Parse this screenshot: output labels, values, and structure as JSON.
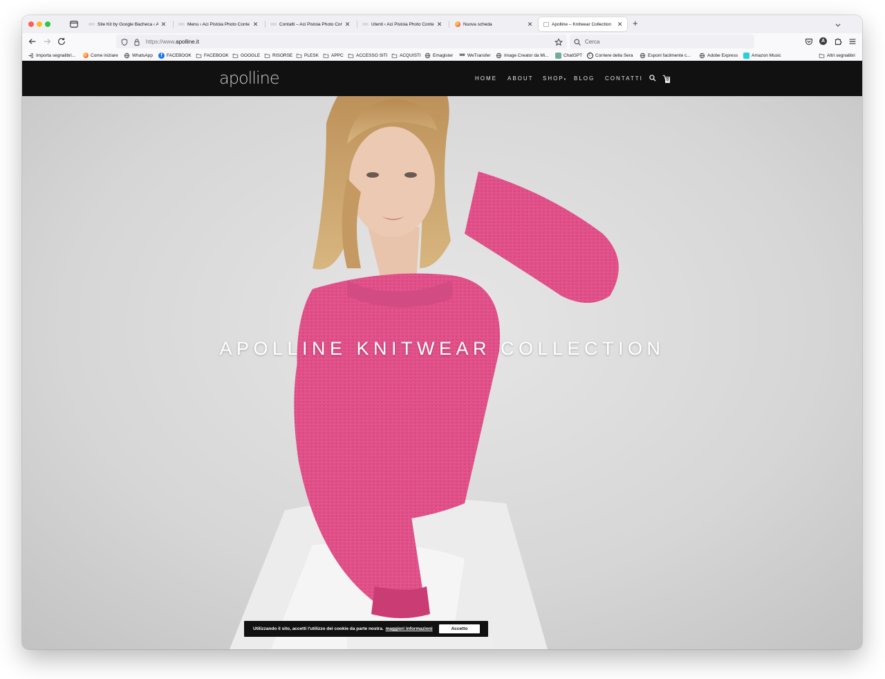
{
  "browser": {
    "tabs": [
      {
        "title": "Site Kit by Google Bacheca ‹ Aci",
        "favicon": "aci-favicon",
        "active": false
      },
      {
        "title": "Menu ‹ Aci Pistoia Photo Conte",
        "favicon": "aci-favicon",
        "active": false
      },
      {
        "title": "Contatti – Aci Pistoia Photo Con",
        "favicon": "aci-favicon",
        "active": false
      },
      {
        "title": "Utenti ‹ Aci Pistoia Photo Conte",
        "favicon": "aci-favicon",
        "active": false
      },
      {
        "title": "Nuova scheda",
        "favicon": "firefox-icon",
        "active": false
      },
      {
        "title": "Apolline – Knitwear Collection",
        "favicon": "apolline-favicon",
        "active": true
      }
    ],
    "url": {
      "prefix": "https://www.",
      "domain": "apolline.it"
    },
    "search_placeholder": "Cerca",
    "account_initial": "A",
    "bookmarks": [
      {
        "label": "Importa segnalibri...",
        "icon": "import-icon"
      },
      {
        "label": "Come iniziare",
        "icon": "firefox-icon"
      },
      {
        "label": "WhatsApp",
        "icon": "globe-icon"
      },
      {
        "label": "FACEBOOK",
        "icon": "facebook-icon"
      },
      {
        "label": "FACEBOOK",
        "icon": "folder-icon"
      },
      {
        "label": "GOOGLE",
        "icon": "folder-icon"
      },
      {
        "label": "RISORSE",
        "icon": "folder-icon"
      },
      {
        "label": "PLESK",
        "icon": "folder-icon"
      },
      {
        "label": "APPC",
        "icon": "folder-icon"
      },
      {
        "label": "ACCESSO SITI",
        "icon": "folder-icon"
      },
      {
        "label": "ACQUISTI",
        "icon": "folder-icon"
      },
      {
        "label": "Emagister",
        "icon": "globe-icon"
      },
      {
        "label": "WeTransfer",
        "icon": "wetransfer-icon"
      },
      {
        "label": "Image Creator da Mi...",
        "icon": "globe-icon"
      },
      {
        "label": "ChatGPT",
        "icon": "chatgpt-icon"
      },
      {
        "label": "Corriere della Sera",
        "icon": "corriere-icon"
      },
      {
        "label": "Esponi facilmente c...",
        "icon": "globe-icon"
      },
      {
        "label": "Adobe Express",
        "icon": "globe-icon"
      },
      {
        "label": "Amazon Music",
        "icon": "amazon-music-icon"
      }
    ],
    "other_bookmarks": "Altri segnalibri"
  },
  "site": {
    "logo": "apolline",
    "menu": [
      "HOME",
      "ABOUT",
      "SHOP",
      "BLOG",
      "CONTATTI"
    ],
    "shop_dropdown_marker": "▾",
    "cart_count": "0",
    "hero_title": "APOLLINE KNITWEAR COLLECTION",
    "cookie": {
      "text": "Utilizzando il sito, accetti l'utilizzo dei cookie da parte nostra.",
      "link": "maggiori informazioni",
      "button": "Accetto"
    }
  },
  "colors": {
    "header_bg": "#111111",
    "sweater_pink": "#e8558c",
    "hero_bg": "#d9d9d9"
  }
}
